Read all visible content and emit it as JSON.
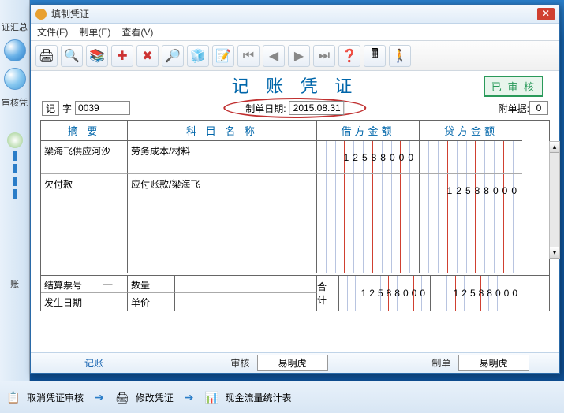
{
  "left_rail": {
    "top_label": "证汇总",
    "mid_label": "审核凭",
    "bottom_label": "账"
  },
  "window": {
    "title": "填制凭证",
    "menu": {
      "file": "文件(F)",
      "make": "制单(E)",
      "view": "查看(V)"
    },
    "doc_title": "记 账 凭 证",
    "stamp": "已 审 核",
    "voucher": {
      "ji": "记",
      "zi": "字",
      "no": "0039"
    },
    "date": {
      "label": "制单日期:",
      "value": "2015.08.31"
    },
    "attach": {
      "label": "附单据:",
      "value": "0"
    },
    "headers": {
      "summary": "摘  要",
      "account": "科 目 名 称",
      "debit": "借方金额",
      "credit": "贷方金额"
    },
    "rows": [
      {
        "summary": "梁海飞供应河沙",
        "account": "劳务成本/材料",
        "debit": "12588000",
        "credit": ""
      },
      {
        "summary": "欠付款",
        "account": "应付账款/梁海飞",
        "debit": "",
        "credit": "12588000"
      },
      {
        "summary": "",
        "account": "",
        "debit": "",
        "credit": ""
      },
      {
        "summary": "",
        "account": "",
        "debit": "",
        "credit": ""
      }
    ],
    "footer": {
      "settle_no_label": "结算票号",
      "settle_no_val": "—",
      "qty_label": "数量",
      "date_label": "发生日期",
      "price_label": "单价",
      "total_label": "合  计",
      "total_debit": "12588000",
      "total_credit": "12588000"
    },
    "bottom": {
      "post": "记账",
      "audit_label": "审核",
      "audit_val": "易明虎",
      "make_label": "制单",
      "make_val": "易明虎"
    }
  },
  "footer_bar": {
    "cancel_audit": "取消凭证审核",
    "modify": "修改凭证",
    "cashflow": "现金流量统计表"
  }
}
